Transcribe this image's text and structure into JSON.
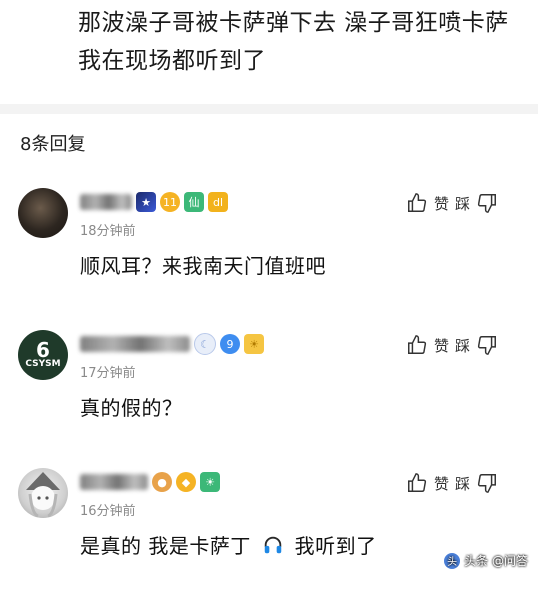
{
  "post": {
    "text": "那波澡子哥被卡萨弹下去 澡子哥狂喷卡萨 我在现场都听到了"
  },
  "reply_count": "8条回复",
  "comments": [
    {
      "time": "18分钟前",
      "text": "顺风耳？来我南天门值班吧",
      "like_label": "赞",
      "dislike_label": "踩",
      "badge_xian": "仙",
      "badge_level": "11",
      "badge_dl": "dl"
    },
    {
      "time": "17分钟前",
      "text": "真的假的？",
      "like_label": "赞",
      "dislike_label": "踩",
      "avatar_text": "6",
      "avatar_sub": "CSYSM",
      "badge_level": "9"
    },
    {
      "time": "16分钟前",
      "text": "是真的 我是卡萨丁",
      "text_after": "我听到了",
      "like_label": "赞",
      "dislike_label": "踩"
    }
  ],
  "watermark": {
    "logo": "头",
    "text": "头条 @问答"
  },
  "colors": {
    "divider_band": "#f3f3f3",
    "time_gray": "#8a8a8a",
    "badge_gold": "#f5b324",
    "badge_green": "#3cb878",
    "badge_blue": "#3e8df0"
  },
  "icons": [
    "like-thumb-icon",
    "dislike-thumb-icon",
    "headphones-icon",
    "vip-diamond-icon",
    "sun-medal-icon",
    "doge-icon"
  ]
}
